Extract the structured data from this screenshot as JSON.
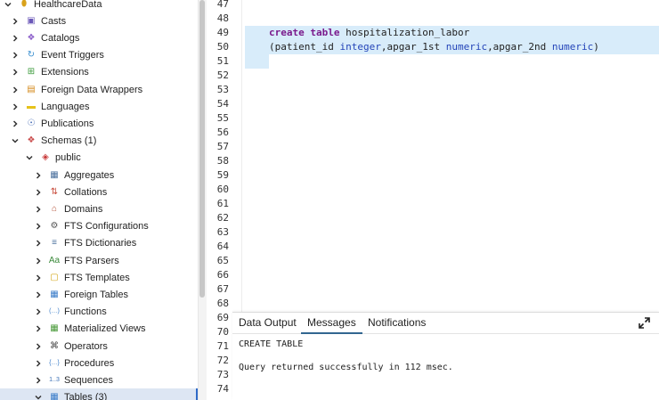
{
  "tree": {
    "items": [
      {
        "label": "HealthcareData",
        "icon": "database-icon",
        "chevron": "down"
      },
      {
        "label": "Casts",
        "icon": "casts-icon",
        "chevron": "right"
      },
      {
        "label": "Catalogs",
        "icon": "catalogs-icon",
        "chevron": "right"
      },
      {
        "label": "Event Triggers",
        "icon": "event-triggers-icon",
        "chevron": "right"
      },
      {
        "label": "Extensions",
        "icon": "extensions-icon",
        "chevron": "right"
      },
      {
        "label": "Foreign Data Wrappers",
        "icon": "foreign-data-wrappers-icon",
        "chevron": "right"
      },
      {
        "label": "Languages",
        "icon": "languages-icon",
        "chevron": "right"
      },
      {
        "label": "Publications",
        "icon": "publications-icon",
        "chevron": "right"
      },
      {
        "label": "Schemas (1)",
        "icon": "schemas-icon",
        "chevron": "down"
      },
      {
        "label": "public",
        "icon": "schema-icon",
        "chevron": "down"
      },
      {
        "label": "Aggregates",
        "icon": "aggregates-icon",
        "chevron": "right"
      },
      {
        "label": "Collations",
        "icon": "collations-icon",
        "chevron": "right"
      },
      {
        "label": "Domains",
        "icon": "domains-icon",
        "chevron": "right"
      },
      {
        "label": "FTS Configurations",
        "icon": "fts-configurations-icon",
        "chevron": "right"
      },
      {
        "label": "FTS Dictionaries",
        "icon": "fts-dictionaries-icon",
        "chevron": "right"
      },
      {
        "label": "FTS Parsers",
        "icon": "fts-parsers-icon",
        "chevron": "right"
      },
      {
        "label": "FTS Templates",
        "icon": "fts-templates-icon",
        "chevron": "right"
      },
      {
        "label": "Foreign Tables",
        "icon": "foreign-tables-icon",
        "chevron": "right"
      },
      {
        "label": "Functions",
        "icon": "functions-icon",
        "chevron": "right"
      },
      {
        "label": "Materialized Views",
        "icon": "materialized-views-icon",
        "chevron": "right"
      },
      {
        "label": "Operators",
        "icon": "operators-icon",
        "chevron": "right"
      },
      {
        "label": "Procedures",
        "icon": "procedures-icon",
        "chevron": "right"
      },
      {
        "label": "Sequences",
        "icon": "sequences-icon",
        "chevron": "right"
      },
      {
        "label": "Tables (3)",
        "icon": "tables-icon",
        "chevron": "down"
      }
    ]
  },
  "editor": {
    "line_numbers": [
      "47",
      "48",
      "49",
      "50",
      "51",
      "52",
      "53",
      "54",
      "55",
      "56",
      "57",
      "58",
      "59",
      "60",
      "61",
      "62",
      "63",
      "64",
      "65",
      "66",
      "67",
      "68",
      "69",
      "70",
      "71",
      "72",
      "73",
      "74"
    ],
    "line1": {
      "kw1": "create",
      "kw2": "table",
      "name": "hospitalization_labor"
    },
    "line2": {
      "open": "(patient_id ",
      "type1": "integer",
      "mid1": ",apgar_1st ",
      "type2": "numeric",
      "mid2": ",apgar_2nd ",
      "type3": "numeric",
      "close": ")"
    }
  },
  "results": {
    "tabs": [
      "Data Output",
      "Messages",
      "Notifications"
    ],
    "active_tab": "Messages",
    "messages": [
      "CREATE TABLE",
      "Query returned successfully in 112 msec."
    ],
    "expand_icon": "expand-icon"
  },
  "colors": {
    "keyword": "#7a1a8c",
    "type": "#2444b8",
    "selection": "#d8ecfa",
    "tree_selected": "#dde6f3",
    "active_tab_underline": "#326690"
  }
}
